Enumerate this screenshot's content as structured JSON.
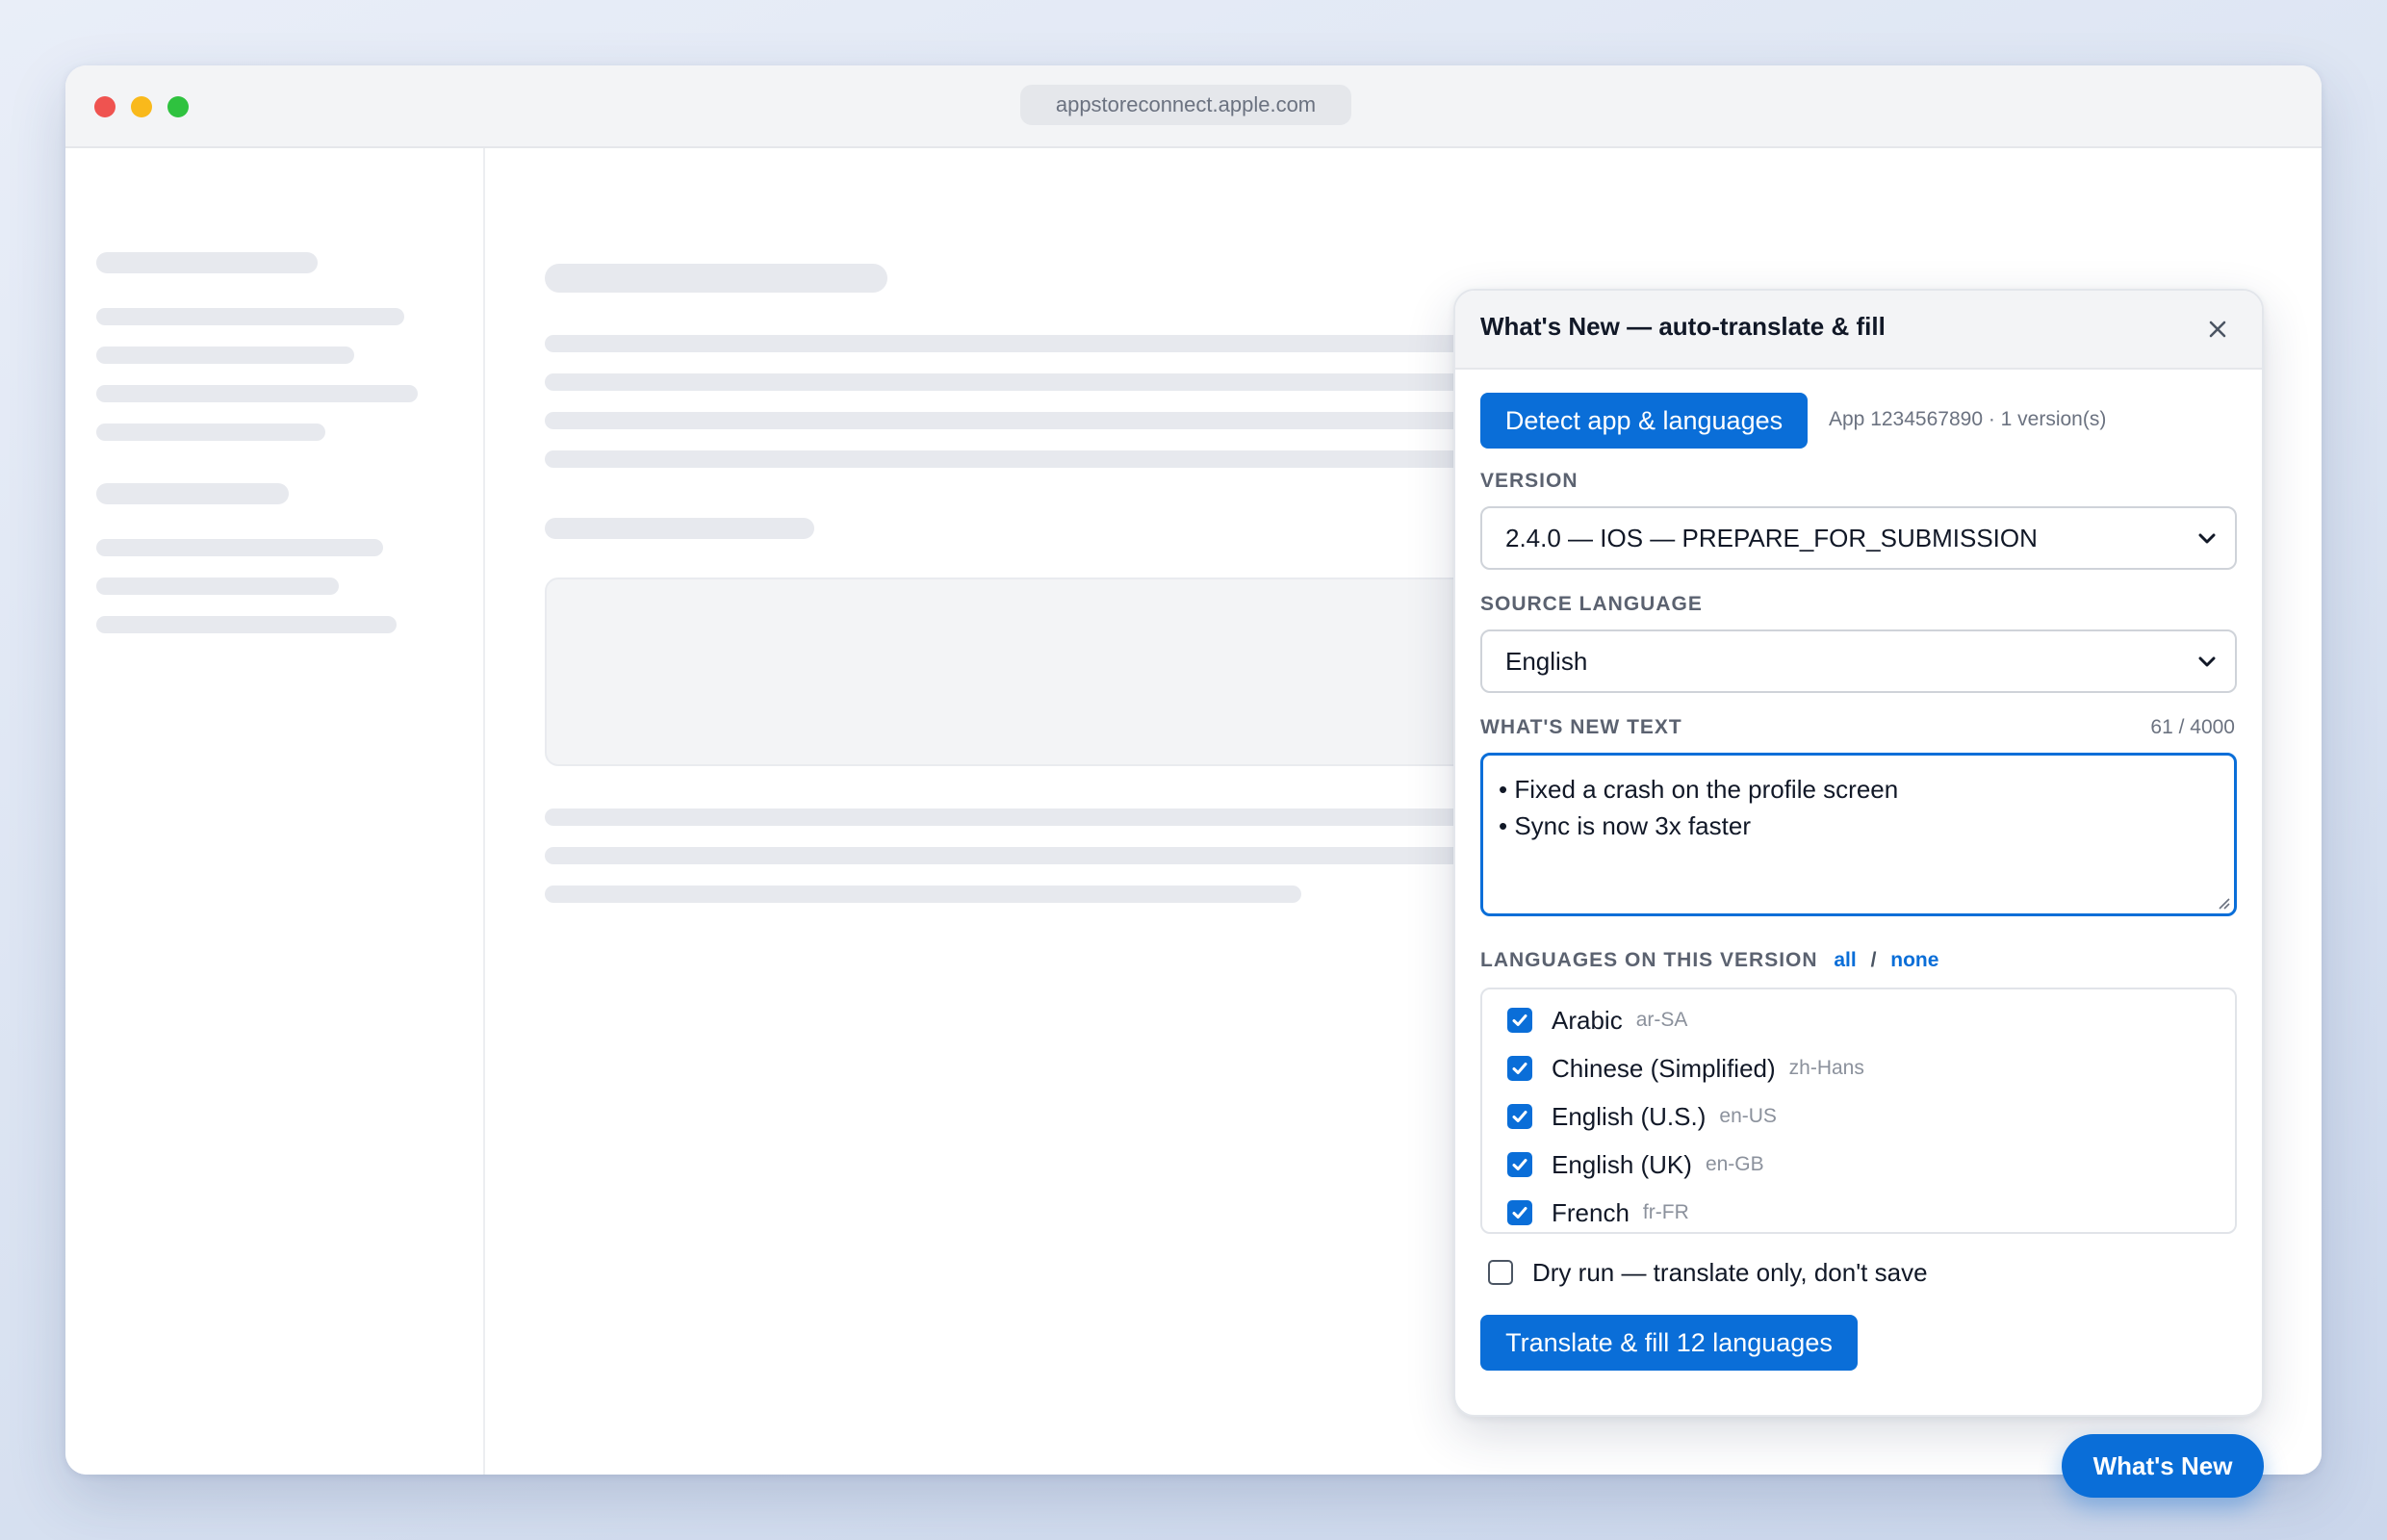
{
  "browser": {
    "url": "appstoreconnect.apple.com"
  },
  "panel": {
    "title": "What's New — auto-translate & fill",
    "detect_button": "Detect app & languages",
    "app_info": "App 1234567890 · 1 version(s)",
    "version": {
      "label": "VERSION",
      "selected": "2.4.0 — IOS — PREPARE_FOR_SUBMISSION"
    },
    "source_language": {
      "label": "SOURCE LANGUAGE",
      "selected": "English"
    },
    "whats_new": {
      "label": "WHAT'S NEW TEXT",
      "counter": "61 / 4000",
      "line1": "• Fixed a crash on the profile screen",
      "line2": "• Sync is now 3x faster"
    },
    "languages": {
      "label": "LANGUAGES ON THIS VERSION",
      "all_link": "all",
      "separator": "/",
      "none_link": "none",
      "items": [
        {
          "name": "Arabic",
          "code": "ar-SA",
          "checked": true
        },
        {
          "name": "Chinese (Simplified)",
          "code": "zh-Hans",
          "checked": true
        },
        {
          "name": "English (U.S.)",
          "code": "en-US",
          "checked": true
        },
        {
          "name": "English (UK)",
          "code": "en-GB",
          "checked": true
        },
        {
          "name": "French",
          "code": "fr-FR",
          "checked": true
        }
      ]
    },
    "dry_run": {
      "label": "Dry run — translate only, don't save",
      "checked": false
    },
    "submit_button": "Translate & fill 12 languages"
  },
  "fab": {
    "label": "What's New"
  },
  "colors": {
    "accent": "#0a6ed8",
    "traffic_red": "#ef5350",
    "traffic_yellow": "#f9b91b",
    "traffic_green": "#2fc23f"
  },
  "icons": {
    "close": "close-icon",
    "select_chevron": "chevron-down-icon",
    "checkbox": "checkmark-icon"
  }
}
